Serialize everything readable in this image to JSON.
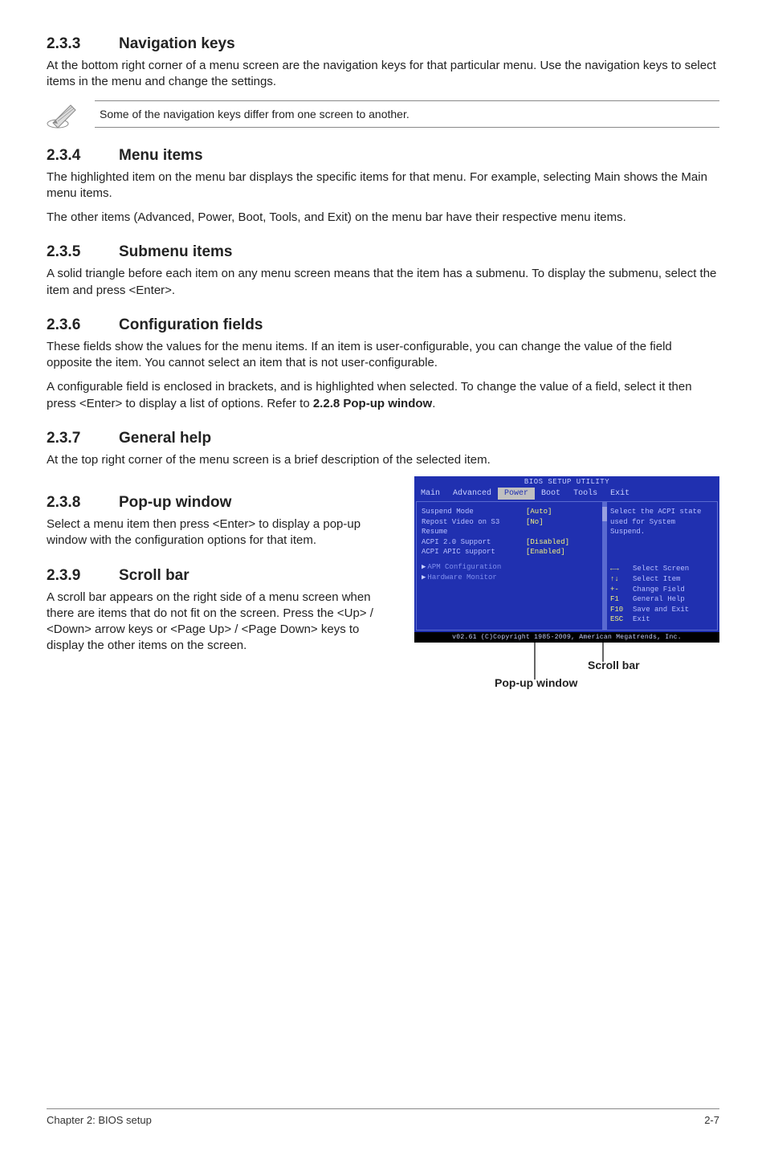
{
  "sections": {
    "s233": {
      "num": "2.3.3",
      "title": "Navigation keys",
      "p1": "At the bottom right corner of a menu screen are the navigation keys for that particular menu. Use the navigation keys to select items in the menu and change the settings.",
      "note": "Some of the navigation keys differ from one screen to another."
    },
    "s234": {
      "num": "2.3.4",
      "title": "Menu items",
      "p1": "The highlighted item on the menu bar  displays the specific items for that menu. For example, selecting Main shows the Main menu items.",
      "p2": "The other items (Advanced, Power, Boot, Tools, and Exit) on the menu bar have their respective menu items."
    },
    "s235": {
      "num": "2.3.5",
      "title": "Submenu items",
      "p1": "A solid triangle before each item on any menu screen means that the item has a submenu. To display the submenu, select the item and press <Enter>."
    },
    "s236": {
      "num": "2.3.6",
      "title": "Configuration fields",
      "p1": "These fields show the values for the menu items. If an item is user-configurable, you can change the value of the field opposite the item. You cannot select an item that is not user-configurable.",
      "p2a": "A configurable field is enclosed in brackets, and is highlighted when selected. To change the value of a field, select it then press <Enter> to display a list of options. Refer to ",
      "p2b": "2.2.8 Pop-up window",
      "p2c": "."
    },
    "s237": {
      "num": "2.3.7",
      "title": "General help",
      "p1": "At the top right corner of the menu screen is a brief description of the selected item."
    },
    "s238": {
      "num": "2.3.8",
      "title": "Pop-up window",
      "p1": "Select a menu item then press <Enter> to display a pop-up window with the configuration options for that item."
    },
    "s239": {
      "num": "2.3.9",
      "title": "Scroll bar",
      "p1": "A scroll bar appears on the right side of a menu screen when there are items that do not fit on the screen. Press the <Up> / <Down> arrow keys or <Page Up> / <Page Down> keys to display the other items on the screen."
    }
  },
  "bios": {
    "title": "BIOS SETUP UTILITY",
    "menu": {
      "main": "Main",
      "advanced": "Advanced",
      "power": "Power",
      "boot": "Boot",
      "tools": "Tools",
      "exit": "Exit"
    },
    "rows": {
      "suspend": {
        "label": "Suspend Mode",
        "value": "[Auto]"
      },
      "repost": {
        "label": "Repost Video on S3 Resume",
        "value": "[No]"
      },
      "acpi20": {
        "label": "ACPI 2.0 Support",
        "value": "[Disabled]"
      },
      "apic": {
        "label": "ACPI APIC support",
        "value": "[Enabled]"
      }
    },
    "subs": {
      "apm": "APM Configuration",
      "hw": "Hardware Monitor"
    },
    "help": {
      "line1": "Select the ACPI state",
      "line2": "used for System",
      "line3": "Suspend."
    },
    "nav": {
      "select_screen": "Select Screen",
      "select_item": "Select Item",
      "change_field": "Change Field",
      "general_help": "General Help",
      "save_exit": "Save and Exit",
      "exit": "Exit",
      "key_lr": "←→",
      "key_ud": "↑↓",
      "key_pm": "+-",
      "key_f1": "F1",
      "key_f10": "F10",
      "key_esc": "ESC"
    },
    "footer": "v02.61 (C)Copyright 1985-2009, American Megatrends, Inc."
  },
  "captions": {
    "scroll": "Scroll bar",
    "popup": "Pop-up window"
  },
  "footer": {
    "left": "Chapter 2: BIOS setup",
    "right": "2-7"
  }
}
